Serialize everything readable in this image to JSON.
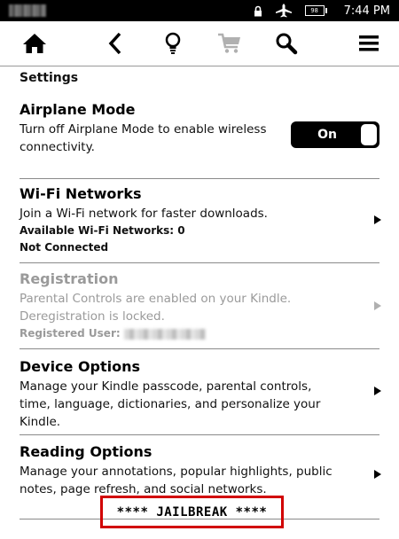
{
  "status_bar": {
    "battery_text": "98",
    "time": "7:44 PM",
    "icons": [
      "lock-icon",
      "airplane-icon",
      "battery-icon"
    ]
  },
  "toolbar": {
    "icons": [
      "home-icon",
      "back-icon",
      "lightbulb-icon",
      "cart-icon",
      "search-icon",
      "menu-icon"
    ]
  },
  "page": {
    "heading": "Settings"
  },
  "airplane_mode": {
    "title": "Airplane Mode",
    "description": "Turn off Airplane Mode to enable wireless connectivity.",
    "toggle_label": "On"
  },
  "wifi": {
    "title": "Wi-Fi Networks",
    "description": "Join a Wi-Fi network for faster downloads.",
    "available": "Available Wi-Fi Networks: 0",
    "status": "Not Connected"
  },
  "registration": {
    "title": "Registration",
    "description": "Parental Controls are enabled on your Kindle. Deregistration is locked.",
    "registered_user_label": "Registered User:"
  },
  "device_options": {
    "title": "Device Options",
    "description": "Manage your Kindle passcode, parental controls, time, language, dictionaries, and personalize your Kindle."
  },
  "reading_options": {
    "title": "Reading Options",
    "description": "Manage your annotations, popular highlights, public notes, page refresh, and social networks."
  },
  "banner": {
    "text": "**** JAILBREAK ****"
  }
}
